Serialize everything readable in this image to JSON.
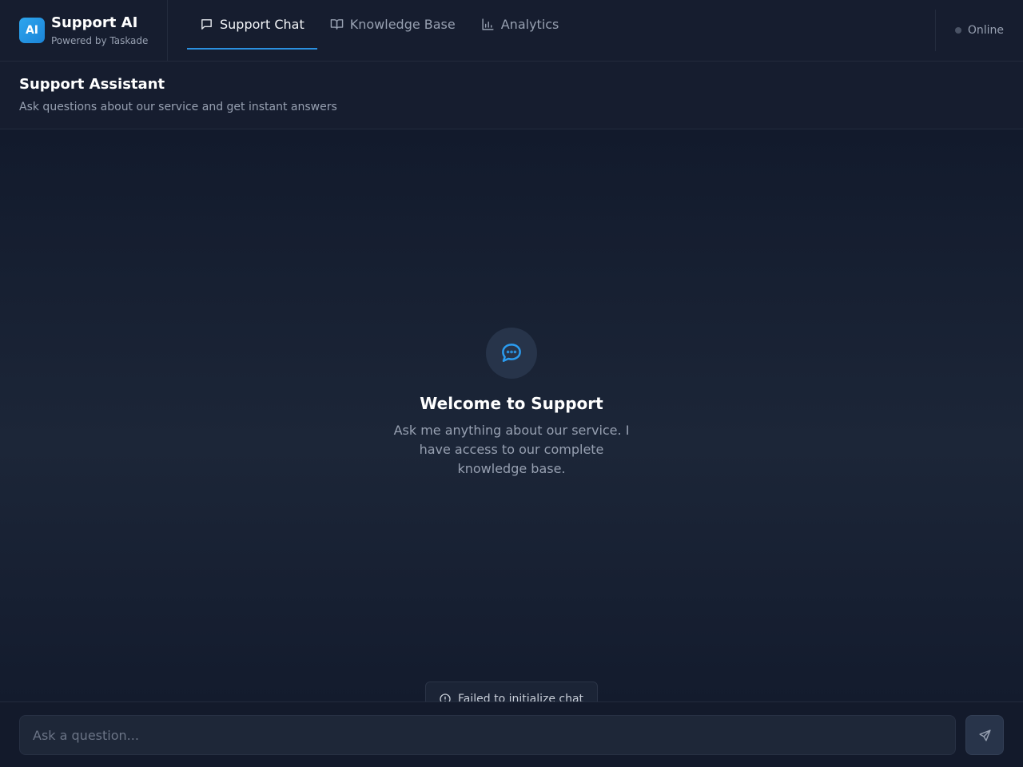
{
  "brand": {
    "logo_text": "AI",
    "title": "Support AI",
    "subtitle": "Powered by Taskade"
  },
  "tabs": [
    {
      "label": "Support Chat",
      "icon": "chat-bubble-icon",
      "active": true
    },
    {
      "label": "Knowledge Base",
      "icon": "book-open-icon",
      "active": false
    },
    {
      "label": "Analytics",
      "icon": "bar-chart-icon",
      "active": false
    }
  ],
  "status": {
    "label": "Online",
    "dot_color": "#4a5365"
  },
  "header": {
    "title": "Support Assistant",
    "subtitle": "Ask questions about our service and get instant answers"
  },
  "welcome": {
    "icon": "chat-dots-icon",
    "title": "Welcome to Support",
    "message": "Ask me anything about our service. I have access to our complete knowledge base."
  },
  "error": {
    "icon": "info-circle-icon",
    "message": "Failed to initialize chat"
  },
  "composer": {
    "placeholder": "Ask a question...",
    "value": "",
    "send_icon": "send-icon"
  },
  "colors": {
    "accent": "#2b90e0",
    "background": "#141b2d",
    "muted_text": "#97a0b1"
  }
}
